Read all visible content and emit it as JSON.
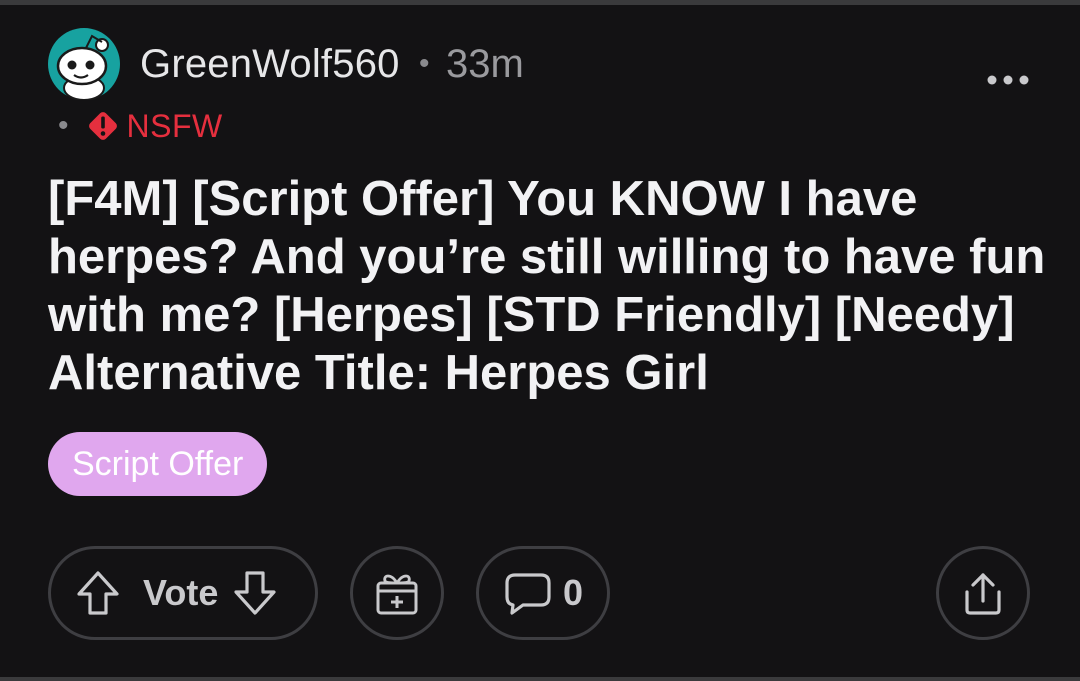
{
  "post": {
    "author": "GreenWolf560",
    "separator": "•",
    "time_ago": "33m",
    "nsfw_separator": "•",
    "nsfw_label": "NSFW",
    "title": "[F4M] [Script Offer] You KNOW I have herpes? And you’re still willing to have fun with me? [Herpes] [STD Friendly] [Needy] Alternative Title: Herpes Girl",
    "flair": "Script Offer"
  },
  "actions": {
    "vote_label": "Vote",
    "comment_count": "0"
  },
  "icons": {
    "avatar": "snoo-avatar-icon",
    "more": "more-options-icon",
    "nsfw": "nsfw-warning-icon",
    "upvote": "upvote-arrow-icon",
    "downvote": "downvote-arrow-icon",
    "award": "gift-award-icon",
    "comment": "comment-bubble-icon",
    "share": "share-icon"
  },
  "colors": {
    "background": "#131214",
    "nsfw": "#e52f3e",
    "flair_bg": "#e0a7ee",
    "avatar_bg": "#17a2a0"
  }
}
